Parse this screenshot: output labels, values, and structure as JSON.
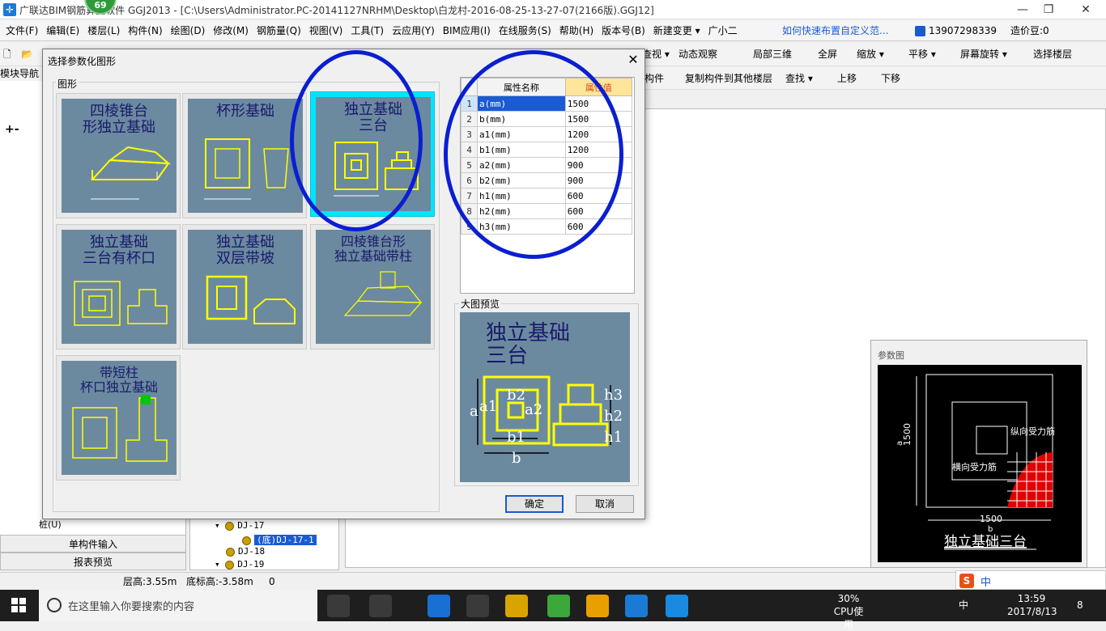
{
  "titlebar": {
    "title": "广联达BIM钢筋算量软件 GGJ2013 - [C:\\Users\\Administrator.PC-20141127NRHM\\Desktop\\白龙村-2016-08-25-13-27-07(2166版).GGJ12]",
    "badge": "69",
    "minimize": "—",
    "restore": "❐",
    "close": "✕"
  },
  "menu": {
    "items": [
      "文件(F)",
      "编辑(E)",
      "楼层(L)",
      "构件(N)",
      "绘图(D)",
      "修改(M)",
      "钢筋量(Q)",
      "视图(V)",
      "工具(T)",
      "云应用(Y)",
      "BIM应用(I)",
      "在线服务(S)",
      "帮助(H)",
      "版本号(B)",
      "新建变更 ▾",
      "广小二"
    ],
    "link": "如何快速布置自定义范...",
    "phone": "13907298339",
    "points": "造价豆:0"
  },
  "toolbar1": {
    "items": [
      "查视 ▾",
      "动态观察",
      "局部三维",
      "全屏",
      "缩放 ▾",
      "平移 ▾",
      "屏幕旋转 ▾",
      "选择楼层"
    ]
  },
  "toolbar2": {
    "items": [
      "构件",
      "复制构件到其他楼层",
      "查找 ▾",
      "上移",
      "下移"
    ]
  },
  "leftnav": {
    "title": "模块导航",
    "bottom1": "单构件输入",
    "bottom2": "报表预览",
    "pile": "桩(U)"
  },
  "tree": {
    "nodes": [
      {
        "label": "DJ-17",
        "selected": false
      },
      {
        "label": "(底)DJ-17-1",
        "selected": true
      },
      {
        "label": "DJ-18",
        "selected": false
      },
      {
        "label": "DJ-19",
        "selected": false
      }
    ]
  },
  "parampanel": {
    "title": "参数图",
    "dim_b": "1500",
    "dim_a": "1500",
    "label_a": "a",
    "label_b": "b",
    "label_long": "纵向受力筋",
    "label_trans": "横向受力筋",
    "caption": "独立基础三台"
  },
  "statusbar": {
    "floor_h": "层高:3.55m",
    "bottom_elev": "底标高:-3.58m",
    "zero": "0"
  },
  "ime": {
    "label": "中"
  },
  "taskbar": {
    "search_placeholder": "在这里输入你要搜索的内容",
    "cpu_pct": "30%",
    "cpu_label": "CPU使用",
    "lang": "中",
    "time": "13:59",
    "date": "2017/8/13",
    "notif": "8"
  },
  "dialog": {
    "title": "选择参数化图形",
    "close": "✕",
    "group_label": "图形",
    "thumbs": [
      {
        "cap1": "四棱锥台",
        "cap2": "形独立基础"
      },
      {
        "cap1": "杯形基础",
        "cap2": ""
      },
      {
        "cap1": "独立基础",
        "cap2": "三台"
      },
      {
        "cap1": "独立基础",
        "cap2": "三台有杯口"
      },
      {
        "cap1": "独立基础",
        "cap2": "双层带坡"
      },
      {
        "cap1": "四棱锥台形",
        "cap2": "独立基础带柱"
      },
      {
        "cap1": "带短柱",
        "cap2": "杯口独立基础"
      }
    ],
    "table": {
      "col_name": "属性名称",
      "col_value": "属性值",
      "rows": [
        {
          "idx": "1",
          "name": "a(mm)",
          "value": "1500"
        },
        {
          "idx": "2",
          "name": "b(mm)",
          "value": "1500"
        },
        {
          "idx": "3",
          "name": "a1(mm)",
          "value": "1200"
        },
        {
          "idx": "4",
          "name": "b1(mm)",
          "value": "1200"
        },
        {
          "idx": "5",
          "name": "a2(mm)",
          "value": "900"
        },
        {
          "idx": "6",
          "name": "b2(mm)",
          "value": "900"
        },
        {
          "idx": "7",
          "name": "h1(mm)",
          "value": "600"
        },
        {
          "idx": "8",
          "name": "h2(mm)",
          "value": "600"
        },
        {
          "idx": "9",
          "name": "h3(mm)",
          "value": "600"
        }
      ]
    },
    "preview_label": "大图预览",
    "preview_cap1": "独立基础",
    "preview_cap2": "三台",
    "preview_labels": {
      "a": "a",
      "a1": "a1",
      "b2": "b2",
      "a2": "a2",
      "b1": "b1",
      "b": "b",
      "h3": "h3",
      "h2": "h2",
      "h1": "h1"
    },
    "ok": "确定",
    "cancel": "取消"
  },
  "colors": {
    "accent": "#1a5ad4",
    "thumb_bg": "#6b8aa0",
    "selected_thumb": "#00e5ff",
    "annotation_ring": "#0a1fd0"
  }
}
